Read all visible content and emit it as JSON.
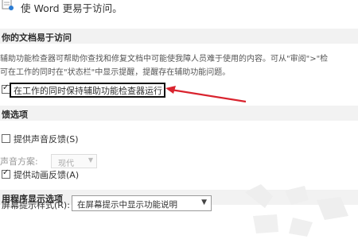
{
  "header": {
    "title": "使 Word 更易于访问。"
  },
  "accessibility_section": {
    "heading": "你的文档易于访问",
    "description_line1": "辅助功能检查器可帮助你查找和修复文档中可能使我障人员难于使用的内容。可从\"审阅\">\"检",
    "description_line2": "可在工作的同时在\"状态栏\"中显示提醒，提醒存在辅助功能问题。",
    "checker_option_label": "在工作的同时保持辅助功能检查器运行",
    "checker_option_checked": true
  },
  "feedback_section": {
    "heading": "馈选项",
    "sound_feedback_label": "提供声音反馈(S)",
    "sound_feedback_checked": false,
    "sound_scheme_label": "声音方案:",
    "sound_scheme_value": "现代",
    "animation_feedback_label": "提供动画反馈(A)",
    "animation_feedback_checked": true
  },
  "display_section": {
    "heading": "用程序显示选项",
    "screentip_label": "屏幕提示样式(R):",
    "screentip_value": "在屏幕提示中显示功能说明"
  },
  "colors": {
    "arrow": "#d9232e",
    "section_bg": "#f2f2f2",
    "highlight_border": "#111111"
  },
  "icons": {
    "document": "document-icon",
    "arrow": "red-arrow-annotation",
    "dropdown": "chevron-down-icon"
  }
}
